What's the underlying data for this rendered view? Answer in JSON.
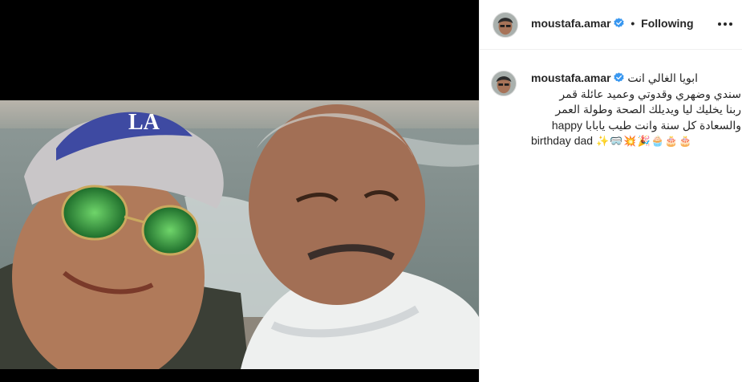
{
  "post": {
    "username": "moustafa.amar",
    "verified": true,
    "separator": "•",
    "follow_status": "Following",
    "more_icon": "ellipsis-icon",
    "caption_lines": [
      "ابويا الغالي انت",
      "سندي وضهري وقدوتي وعميد عائلة قمر",
      "ربنا يخليك ليا ويديلك الصحة وطولة العمر",
      "والسعادة كل سنة وانت طيب يابابا happy"
    ],
    "caption_last": "birthday dad",
    "caption_emojis": "✨🥽💥🎉🧁🎂🎂"
  },
  "colors": {
    "text": "#262626",
    "verified": "#3897f0",
    "divider": "#efefef",
    "media_bg": "#000000"
  }
}
